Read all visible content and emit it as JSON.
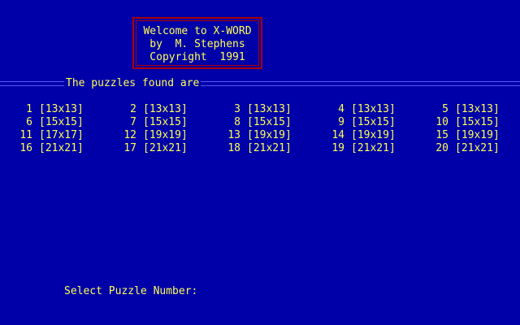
{
  "colors": {
    "background": "#0000a8",
    "text": "#ffff55",
    "box_border": "#a80000",
    "rule": "#5555ff"
  },
  "title": {
    "line1": "Welcome to X-WORD",
    "line2": "by  M. Stephens",
    "line3": "Copyright  1991"
  },
  "section_label": "The puzzles found are",
  "puzzles": [
    {
      "num": "1",
      "size": "[13x13]"
    },
    {
      "num": "2",
      "size": "[13x13]"
    },
    {
      "num": "3",
      "size": "[13x13]"
    },
    {
      "num": "4",
      "size": "[13x13]"
    },
    {
      "num": "5",
      "size": "[13x13]"
    },
    {
      "num": "6",
      "size": "[15x15]"
    },
    {
      "num": "7",
      "size": "[15x15]"
    },
    {
      "num": "8",
      "size": "[15x15]"
    },
    {
      "num": "9",
      "size": "[15x15]"
    },
    {
      "num": "10",
      "size": "[15x15]"
    },
    {
      "num": "11",
      "size": "[17x17]"
    },
    {
      "num": "12",
      "size": "[19x19]"
    },
    {
      "num": "13",
      "size": "[19x19]"
    },
    {
      "num": "14",
      "size": "[19x19]"
    },
    {
      "num": "15",
      "size": "[19x19]"
    },
    {
      "num": "16",
      "size": "[21x21]"
    },
    {
      "num": "17",
      "size": "[21x21]"
    },
    {
      "num": "18",
      "size": "[21x21]"
    },
    {
      "num": "19",
      "size": "[21x21]"
    },
    {
      "num": "20",
      "size": "[21x21]"
    }
  ],
  "prompt": {
    "label": "Select Puzzle Number:",
    "value": ""
  }
}
